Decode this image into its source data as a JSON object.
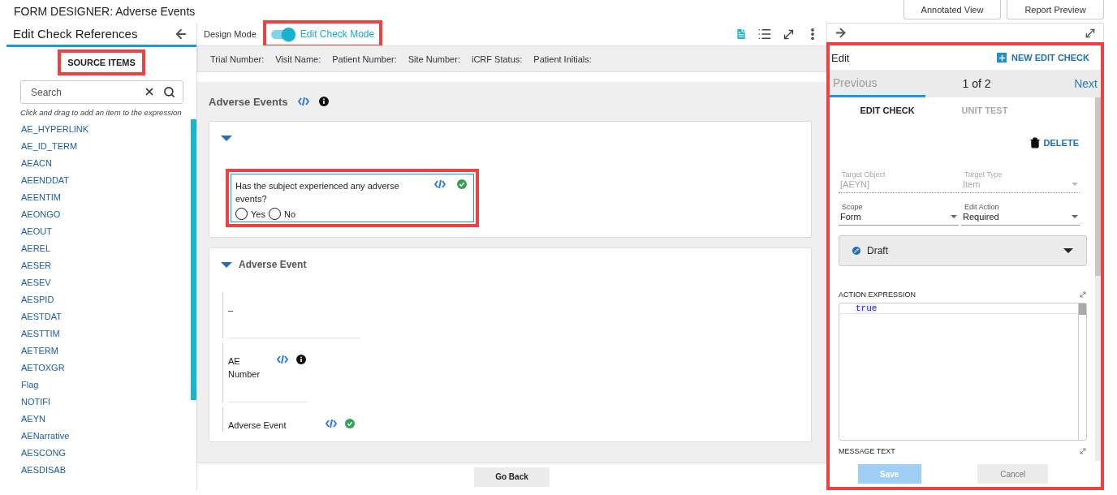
{
  "title": "FORM DESIGNER: Adverse Events",
  "header_buttons": [
    "Annotated View",
    "Report Preview"
  ],
  "references": {
    "title": "Edit Check References",
    "tab": {
      "label": "SOURCE ITEMS",
      "selected": true,
      "highlighted": true
    },
    "search": {
      "placeholder": "Search"
    },
    "hint": "Click and drag to add an item to the expression",
    "items": [
      "AE_HYPERLINK",
      "AE_ID_TERM",
      "AEACN",
      "AEENDDAT",
      "AEENTIM",
      "AEONGO",
      "AEOUT",
      "AEREL",
      "AESER",
      "AESEV",
      "AESPID",
      "AESTDAT",
      "AESTTIM",
      "AETERM",
      "AETOXGR",
      "Flag",
      "NOTIFI",
      "AEYN",
      "AENarrative",
      "AESCONG",
      "AESDISAB"
    ]
  },
  "mode": {
    "design_label": "Design Mode",
    "on": true,
    "edit_label": "Edit Check Mode",
    "highlighted": true
  },
  "info_fields": [
    "Trial Number:",
    "Visit Name:",
    "Patient Number:",
    "Site Number:",
    "iCRF Status:",
    "Patient Initials:"
  ],
  "form": {
    "title": "Adverse Events",
    "has_info": true,
    "sections": [
      {
        "expanded": true,
        "items": [
          {
            "kind": "question",
            "label": "Has the subject experienced any adverse events?",
            "validated": true,
            "highlighted": true,
            "options": [
              {
                "label": "Yes",
                "selected": false
              },
              {
                "label": "No",
                "selected": false
              }
            ]
          }
        ]
      },
      {
        "title": "Adverse Event",
        "expanded": true,
        "items": [
          {
            "kind": "text",
            "label": "–"
          },
          {
            "kind": "field",
            "label": "AE Number",
            "has_info": true
          },
          {
            "kind": "field",
            "label": "Adverse Event",
            "validated": true
          }
        ]
      }
    ]
  },
  "go_back": "Go Back",
  "edit_panel": {
    "title": "Edit",
    "new_button": "NEW EDIT CHECK",
    "highlighted": true,
    "pager": {
      "previous": {
        "label": "Previous",
        "disabled": true
      },
      "position": "1 of 2",
      "next": {
        "label": "Next",
        "disabled": false
      }
    },
    "tabs": [
      {
        "label": "EDIT CHECK",
        "selected": true
      },
      {
        "label": "UNIT TEST",
        "selected": false
      }
    ],
    "delete": "DELETE",
    "fields": [
      {
        "kind": "text",
        "label": "Target Object",
        "value": "[AEYN]",
        "disabled": true
      },
      {
        "kind": "select",
        "label": "Target Type",
        "value": "Item",
        "disabled": true
      },
      {
        "kind": "select",
        "label": "Scope",
        "value": "Form",
        "disabled": false
      },
      {
        "kind": "select",
        "label": "Edit Action",
        "value": "Required",
        "disabled": false
      }
    ],
    "status": "Draft",
    "expression": {
      "label": "ACTION EXPRESSION",
      "code": "true"
    },
    "message_label": "MESSAGE TEXT",
    "save": {
      "label": "Save",
      "disabled": true
    },
    "cancel": "Cancel"
  }
}
